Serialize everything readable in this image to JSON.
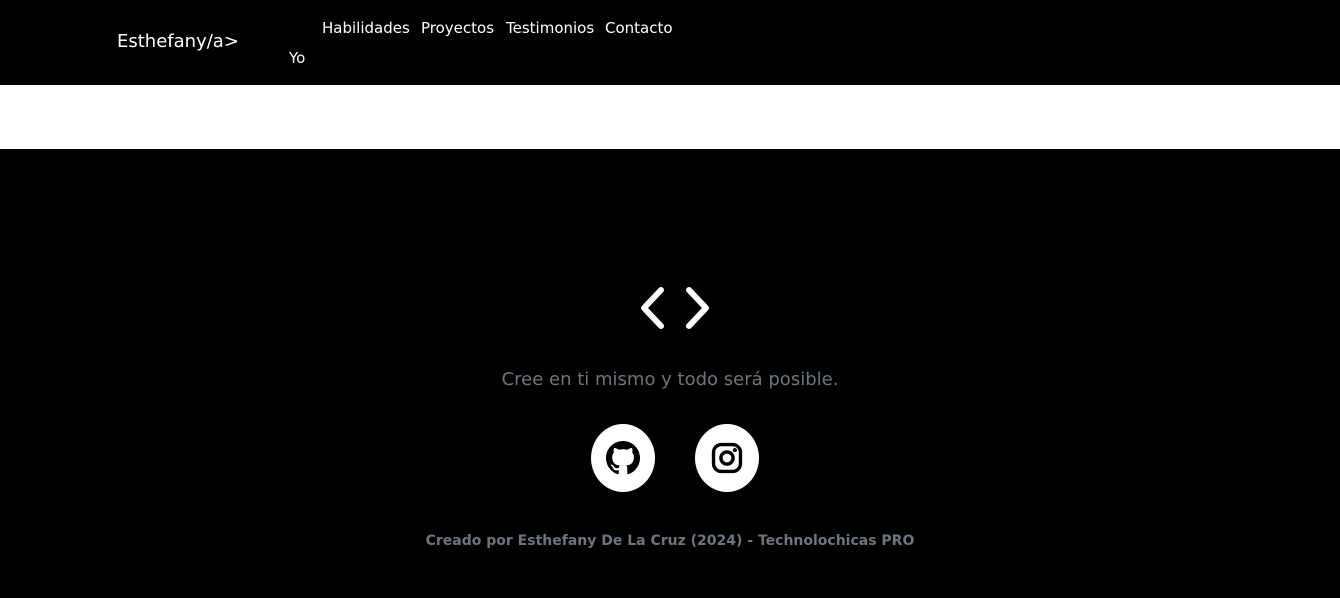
{
  "nav": {
    "brand": "Esthefany/a>",
    "links": [
      {
        "label": "Yo"
      },
      {
        "label": "Habilidades"
      },
      {
        "label": "Proyectos"
      },
      {
        "label": "Testimonios"
      },
      {
        "label": "Contacto"
      }
    ]
  },
  "footer": {
    "icon": "code-brackets-icon",
    "quote": "Cree en ti mismo y todo será posible.",
    "social": [
      {
        "icon": "github-icon"
      },
      {
        "icon": "instagram-icon"
      }
    ],
    "credit": "Creado por Esthefany De La Cruz (2024) - Technolochicas PRO"
  },
  "colors": {
    "background": "#000000",
    "text": "#ffffff",
    "muted": "#6c757d"
  }
}
